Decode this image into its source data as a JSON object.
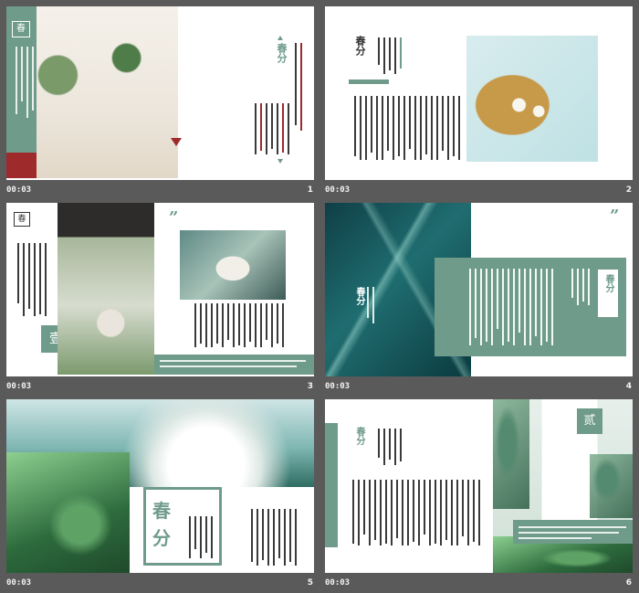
{
  "slides": [
    {
      "time": "00:03",
      "num": "1",
      "title": "春分",
      "box_char": "春"
    },
    {
      "time": "00:03",
      "num": "2",
      "title": "春分"
    },
    {
      "time": "00:03",
      "num": "3",
      "box_char": "春",
      "badge": "壹",
      "quote": "”"
    },
    {
      "time": "00:03",
      "num": "4",
      "title": "春分",
      "quote": "”",
      "label": "春分"
    },
    {
      "time": "00:03",
      "num": "5",
      "big1": "春",
      "big2": "分"
    },
    {
      "time": "00:03",
      "num": "6",
      "title": "春分",
      "badge": "贰"
    }
  ]
}
